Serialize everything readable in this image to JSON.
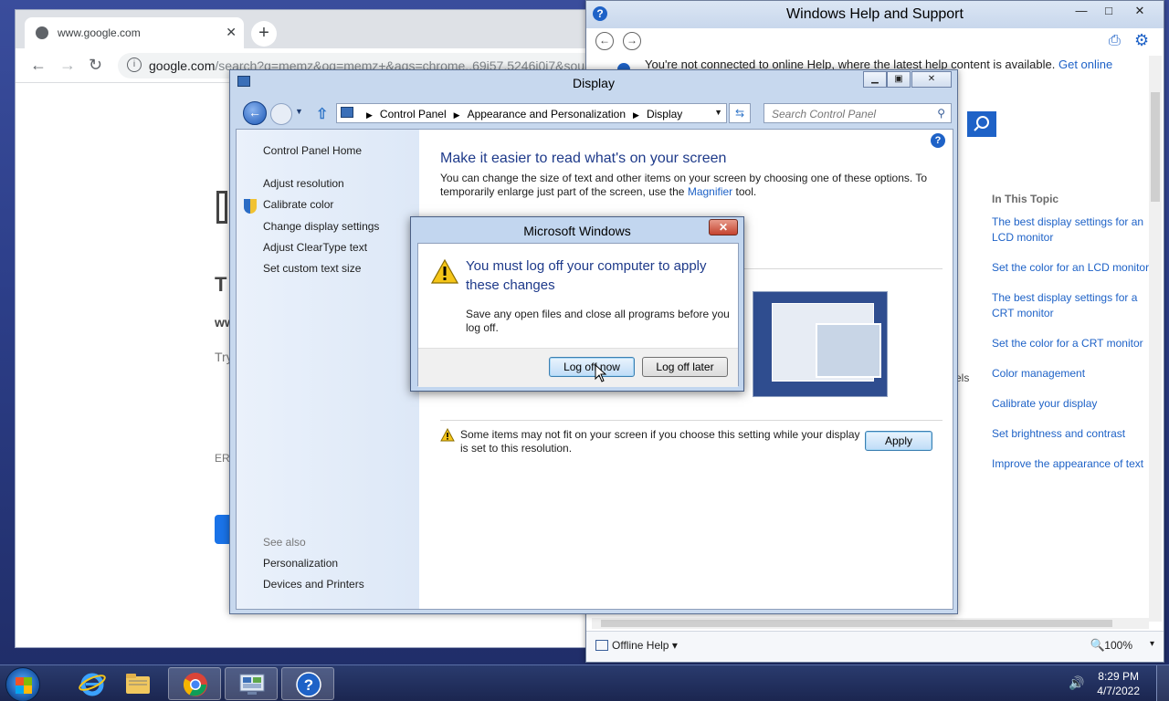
{
  "chrome": {
    "tab_title": "www.google.com",
    "url_host": "google.com",
    "url_rest": "/search?q=memz&oq=memz+&aqs=chrome..69i57.5246j0j7&sou",
    "bg_text_T": "T",
    "bg_text_ww": "ww",
    "bg_text_try": "Try",
    "bg_text_err": "ER"
  },
  "help": {
    "title": "Windows Help and Support",
    "notice_text": "You're not connected to online Help, where the latest help content is available.",
    "notice_link": "Get online",
    "in_this_topic": "In This Topic",
    "topics": [
      "The best display settings for an LCD monitor",
      "Set the color for an LCD monitor",
      "The best display settings for a CRT monitor",
      "Set the color for a CRT monitor",
      "Color management",
      "Calibrate your display",
      "Set brightness and contrast",
      "Improve the appearance of text"
    ],
    "status_offline": "Offline Help",
    "status_zoom": "100%",
    "bg_fragment": "els"
  },
  "display": {
    "title": "Display",
    "breadcrumbs": [
      "Control Panel",
      "Appearance and Personalization",
      "Display"
    ],
    "search_placeholder": "Search Control Panel",
    "left_links": [
      "Control Panel Home",
      "Adjust resolution",
      "Calibrate color",
      "Change display settings",
      "Adjust ClearType text",
      "Set custom text size"
    ],
    "see_also": "See also",
    "see_also_links": [
      "Personalization",
      "Devices and Printers"
    ],
    "heading": "Make it easier to read what's on your screen",
    "desc_1": "You can change the size of text and other items on your screen by choosing one of these options. To temporarily enlarge just part of the screen, use the",
    "desc_link": "Magnifier",
    "desc_2": "tool.",
    "warning": "Some items may not fit on your screen if you choose this setting while your display is set to this resolution.",
    "apply": "Apply"
  },
  "dialog": {
    "title": "Microsoft Windows",
    "message": "You must log off your computer to apply these changes",
    "submessage": "Save any open files and close all programs before you log off.",
    "btn_now": "Log off now",
    "btn_later": "Log off later"
  },
  "taskbar": {
    "time": "8:29 PM",
    "date": "4/7/2022"
  }
}
